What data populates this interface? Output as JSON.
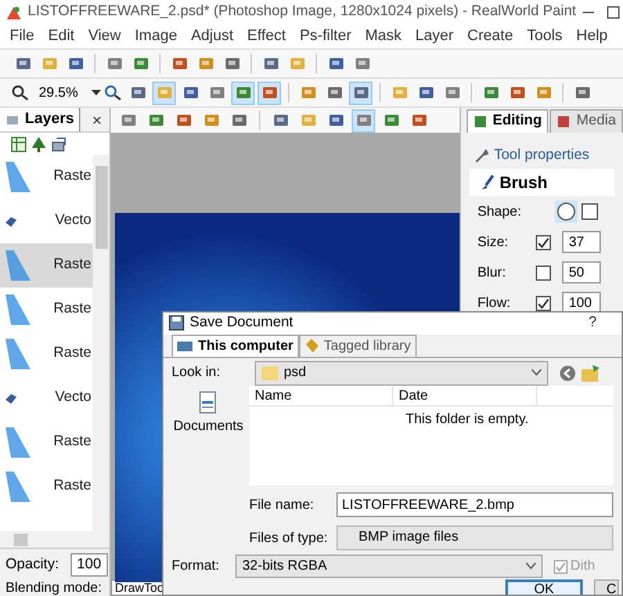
{
  "window": {
    "title": "LISTOFFREEWARE_2.psd* (Photoshop Image, 1280x1024 pixels) - RealWorld Paint"
  },
  "menu": [
    "File",
    "Edit",
    "View",
    "Image",
    "Adjust",
    "Effect",
    "Ps-filter",
    "Mask",
    "Layer",
    "Create",
    "Tools",
    "Help"
  ],
  "zoom": {
    "value": "29.5%"
  },
  "layers_panel": {
    "title": "Layers",
    "close": "×",
    "layers": [
      {
        "name": "Raste",
        "kind": "raster",
        "selected": false
      },
      {
        "name": "Vecto",
        "kind": "vector",
        "selected": false
      },
      {
        "name": "Raste",
        "kind": "raster",
        "selected": true
      },
      {
        "name": "Raste",
        "kind": "raster",
        "selected": false
      },
      {
        "name": "Raste",
        "kind": "raster",
        "selected": false
      },
      {
        "name": "Vecto",
        "kind": "vector",
        "selected": false
      },
      {
        "name": "Raste",
        "kind": "raster",
        "selected": false
      },
      {
        "name": "Raste",
        "kind": "raster",
        "selected": false
      }
    ],
    "opacity_label": "Opacity:",
    "opacity": "100",
    "blending_label": "Blending mode:"
  },
  "right_panel": {
    "tabs": [
      {
        "label": "Editing",
        "selected": true
      },
      {
        "label": "Media",
        "selected": false
      }
    ],
    "section": "Tool properties",
    "tool": "Brush",
    "shape_label": "Shape:",
    "properties": [
      {
        "label": "Size:",
        "checked": true,
        "value": "37"
      },
      {
        "label": "Blur:",
        "checked": false,
        "value": "50"
      },
      {
        "label": "Flow:",
        "checked": true,
        "value": "100"
      }
    ]
  },
  "status_bar": {
    "text": "DrawToo"
  },
  "dialog": {
    "title": "Save Document",
    "help": "?",
    "tabs": [
      {
        "label": "This computer",
        "selected": true
      },
      {
        "label": "Tagged library",
        "selected": false
      }
    ],
    "look_in_label": "Look in:",
    "look_in": "psd",
    "place": "Documents",
    "columns": [
      "Name",
      "Date"
    ],
    "empty_message": "This folder is empty.",
    "file_name_label": "File name:",
    "file_name": "LISTOFFREEWARE_2.bmp",
    "file_type_label": "Files of type:",
    "file_type": "BMP image files",
    "format_label": "Format:",
    "format": "32-bits RGBA",
    "dither": {
      "label": "Dith",
      "checked": true,
      "disabled": true
    },
    "buttons": [
      "OK",
      "C"
    ]
  }
}
